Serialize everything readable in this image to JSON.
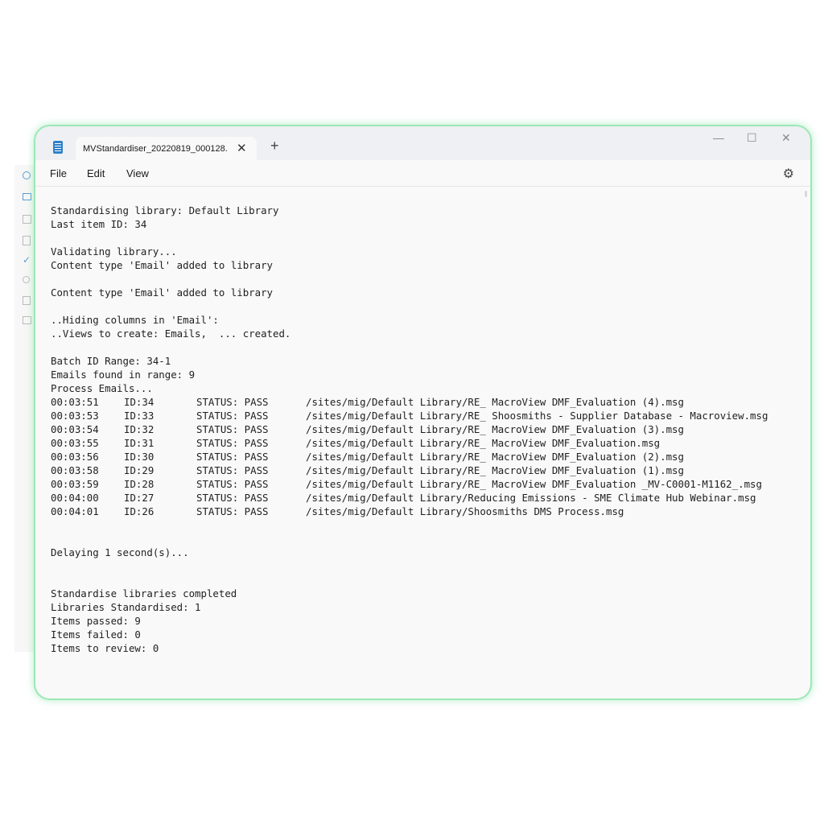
{
  "window": {
    "tab_title": "MVStandardiser_20220819_000128.",
    "tab_close": "✕",
    "new_tab": "+",
    "minimize": "—",
    "maximize": "☐",
    "close": "✕"
  },
  "menu": {
    "file": "File",
    "edit": "Edit",
    "view": "View",
    "settings_icon": "⚙"
  },
  "log": {
    "intro": [
      "Standardising library: Default Library",
      "Last item ID: 34",
      "",
      "Validating library...",
      "Content type 'Email' added to library",
      "",
      "Content type 'Email' added to library",
      "",
      "..Hiding columns in 'Email':",
      "..Views to create: Emails,  ... created.",
      "",
      "Batch ID Range: 34-1",
      "Emails found in range: 9",
      "Process Emails..."
    ],
    "entries": [
      {
        "time": "00:03:51",
        "id": "ID:34",
        "status": "STATUS: PASS",
        "path": "/sites/mig/Default Library/RE_ MacroView DMF_Evaluation (4).msg"
      },
      {
        "time": "00:03:53",
        "id": "ID:33",
        "status": "STATUS: PASS",
        "path": "/sites/mig/Default Library/RE_ Shoosmiths - Supplier Database - Macroview.msg"
      },
      {
        "time": "00:03:54",
        "id": "ID:32",
        "status": "STATUS: PASS",
        "path": "/sites/mig/Default Library/RE_ MacroView DMF_Evaluation (3).msg"
      },
      {
        "time": "00:03:55",
        "id": "ID:31",
        "status": "STATUS: PASS",
        "path": "/sites/mig/Default Library/RE_ MacroView DMF_Evaluation.msg"
      },
      {
        "time": "00:03:56",
        "id": "ID:30",
        "status": "STATUS: PASS",
        "path": "/sites/mig/Default Library/RE_ MacroView DMF_Evaluation (2).msg"
      },
      {
        "time": "00:03:58",
        "id": "ID:29",
        "status": "STATUS: PASS",
        "path": "/sites/mig/Default Library/RE_ MacroView DMF_Evaluation (1).msg"
      },
      {
        "time": "00:03:59",
        "id": "ID:28",
        "status": "STATUS: PASS",
        "path": "/sites/mig/Default Library/RE_ MacroView DMF_Evaluation _MV-C0001-M1162_.msg"
      },
      {
        "time": "00:04:00",
        "id": "ID:27",
        "status": "STATUS: PASS",
        "path": "/sites/mig/Default Library/Reducing Emissions - SME Climate Hub Webinar.msg"
      },
      {
        "time": "00:04:01",
        "id": "ID:26",
        "status": "STATUS: PASS",
        "path": "/sites/mig/Default Library/Shoosmiths DMS Process.msg"
      }
    ],
    "delay": "Delaying 1 second(s)...",
    "summary": [
      "Standardise libraries completed",
      "Libraries Standardised: 1",
      "Items passed: 9",
      "Items failed: 0",
      "Items to review: 0"
    ]
  },
  "colors": {
    "border_accent": "#9be8b5",
    "app_icon": "#2f80c8"
  }
}
